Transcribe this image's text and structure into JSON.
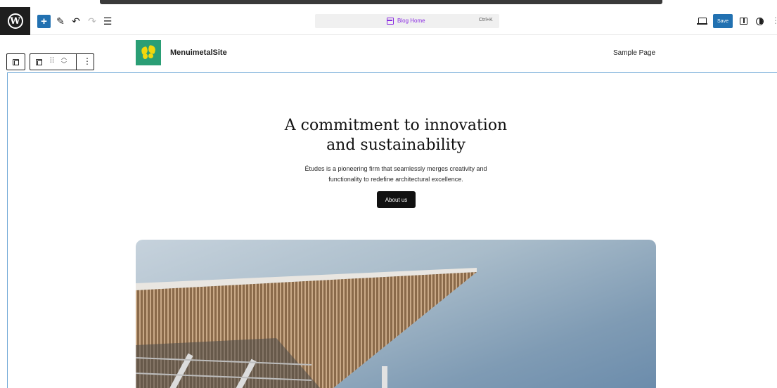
{
  "editor": {
    "command_bar": {
      "title": "Blog Home",
      "shortcut": "Ctrl+K"
    },
    "save_label": "Save"
  },
  "site": {
    "title": "MenuimetalSite",
    "nav": [
      "Sample Page"
    ]
  },
  "hero": {
    "heading_line1": "A commitment to innovation",
    "heading_line2": "and sustainability",
    "subtitle_line1": "Études is a pioneering firm that seamlessly merges creativity and",
    "subtitle_line2": "functionality to redefine architectural excellence.",
    "button_label": "About us"
  },
  "icons": {
    "wordpress": "wordpress-logo-icon",
    "inserter": "plus-icon",
    "tools": "pen-icon",
    "undo": "undo-icon",
    "redo": "redo-icon",
    "list_view": "list-view-icon",
    "command": "document-icon",
    "device_preview": "laptop-icon",
    "settings": "sidebar-icon",
    "styles": "half-circle-icon",
    "options": "more-vertical-icon"
  },
  "colors": {
    "accent": "#2271b1",
    "command_text": "#8a2be2",
    "logo_bg": "#2a9e75",
    "logo_fg": "#f2d70d",
    "button_bg": "#111111"
  }
}
